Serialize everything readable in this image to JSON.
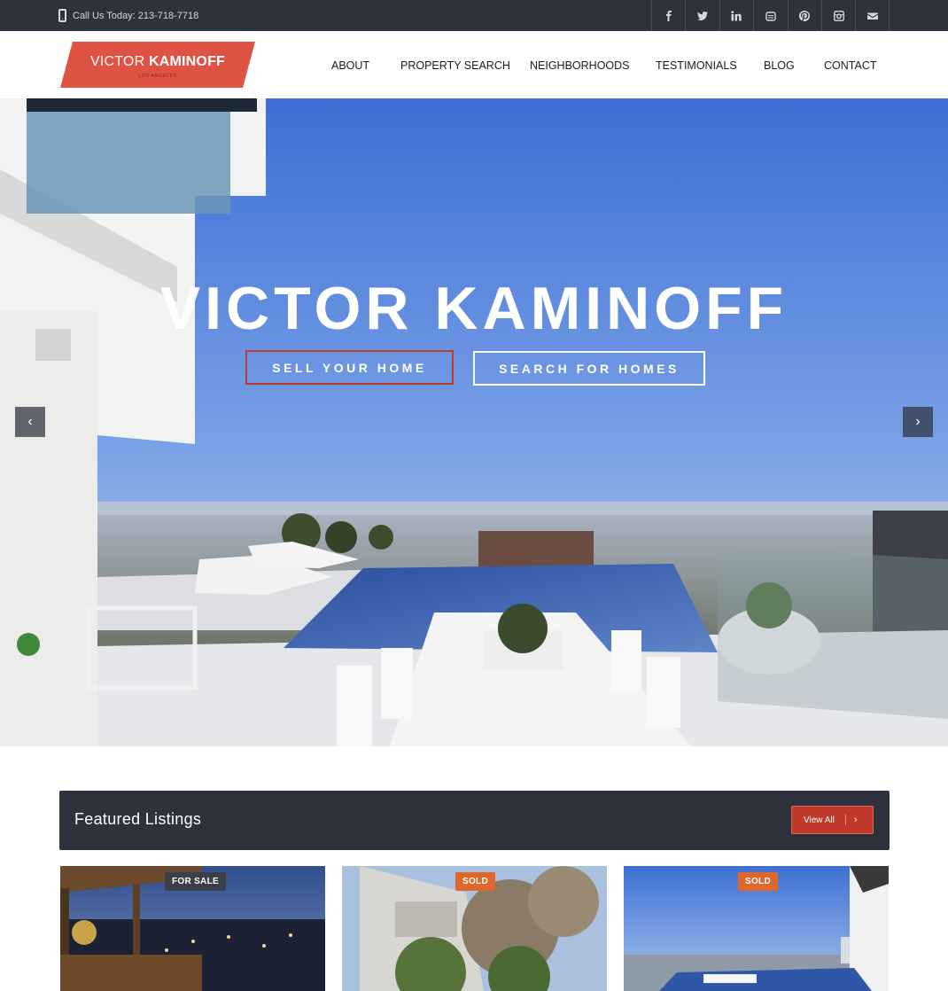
{
  "topbar": {
    "phone_text": "Call Us Today: 213-718-7718",
    "social_icons": [
      "facebook-icon",
      "twitter-icon",
      "linkedin-icon",
      "youtube-icon",
      "pinterest-icon",
      "instagram-icon",
      "envelope-icon"
    ]
  },
  "logo": {
    "first": "VICTOR ",
    "last": "KAMINOFF",
    "sub": "LOS ANGELES",
    "color": "#e05244"
  },
  "nav": {
    "items": [
      "ABOUT",
      "PROPERTY SEARCH",
      "NEIGHBORHOODS",
      "TESTIMONIALS",
      "BLOG",
      "CONTACT"
    ]
  },
  "hero": {
    "title": "VICTOR KAMINOFF",
    "sell_label": "SELL YOUR HOME",
    "search_label": "SEARCH FOR HOMES",
    "prev_icon": "‹",
    "next_icon": "›"
  },
  "featured": {
    "title": "Featured Listings",
    "view_all_label": "View All",
    "view_all_icon": "›"
  },
  "listings": [
    {
      "badge": "FOR SALE"
    },
    {
      "badge": "SOLD"
    },
    {
      "badge": "SOLD"
    }
  ],
  "colors": {
    "dark": "#2e323c",
    "accent": "#c0392b",
    "sold": "#e0672c"
  }
}
